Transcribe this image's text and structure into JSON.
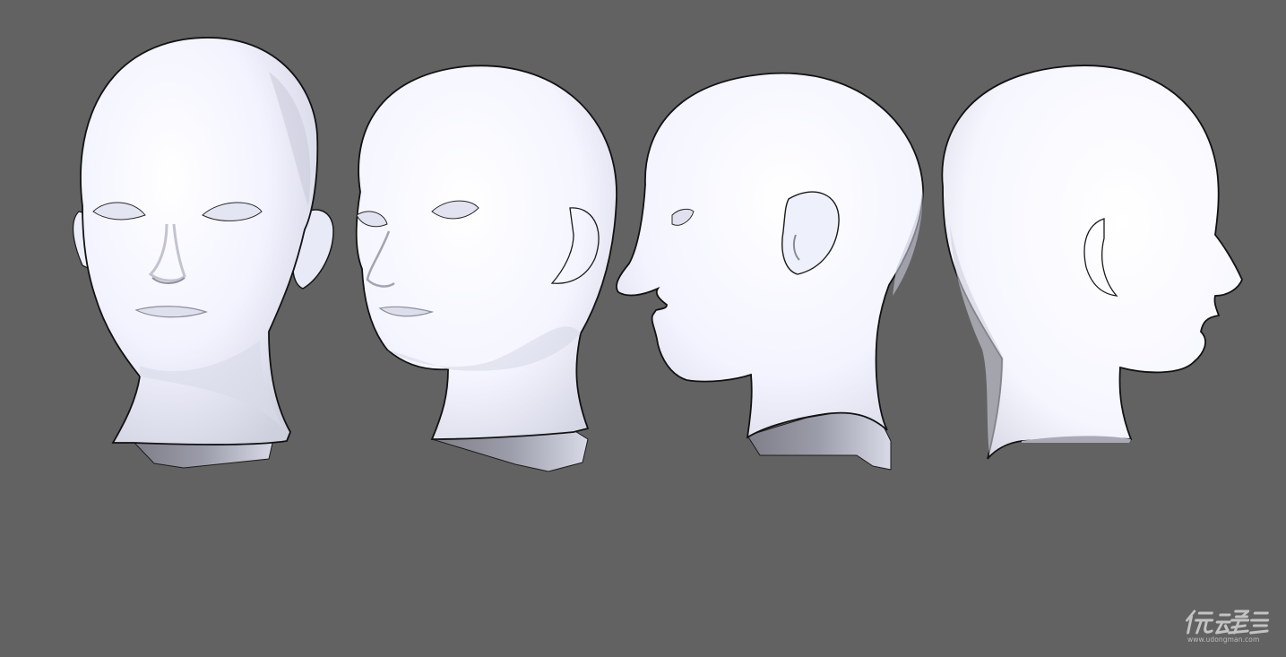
{
  "viewport": {
    "background": "#626262"
  },
  "model": {
    "base_color": "#f4f5ff",
    "shade_color": "#c9cad8",
    "outline_color": "#141414"
  },
  "views": [
    {
      "name": "head-front-view"
    },
    {
      "name": "head-three-quarter-view"
    },
    {
      "name": "head-profile-view"
    },
    {
      "name": "head-back-three-quarter-view"
    }
  ],
  "watermark": {
    "logo_text": "优动漫",
    "url": "www.udongman.com"
  }
}
